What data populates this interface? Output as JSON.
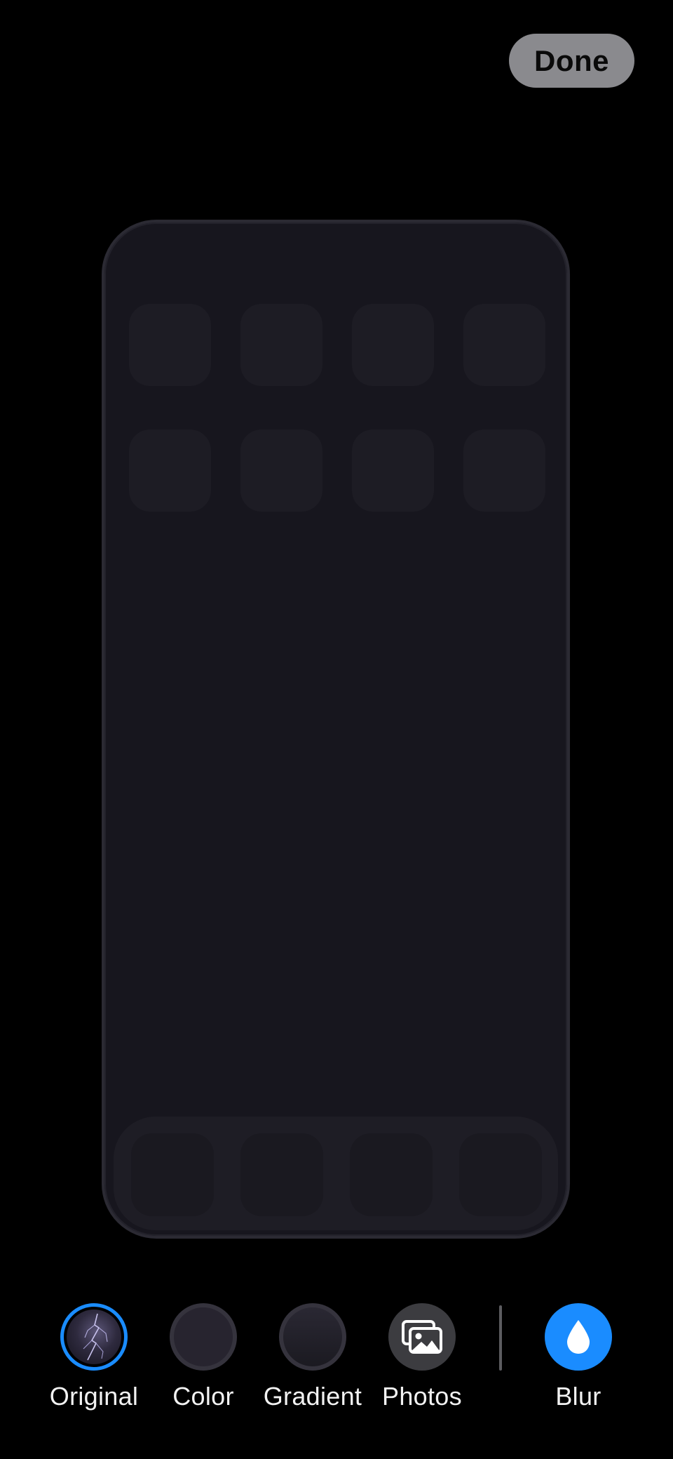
{
  "header": {
    "done_label": "Done"
  },
  "preview": {
    "grid_rows": 2,
    "grid_columns": 4,
    "dock_slots": 4
  },
  "options": [
    {
      "label": "Original",
      "icon": "wallpaper-thumbnail-icon",
      "selected": true
    },
    {
      "label": "Color",
      "icon": "color-swatch-icon",
      "selected": false
    },
    {
      "label": "Gradient",
      "icon": "gradient-swatch-icon",
      "selected": false
    },
    {
      "label": "Photos",
      "icon": "photos-icon",
      "selected": false
    },
    {
      "label": "Blur",
      "icon": "droplet-icon",
      "selected": true
    }
  ],
  "colors": {
    "accent": "#1a8cff",
    "background": "#000000",
    "preview_background": "#17161e"
  }
}
